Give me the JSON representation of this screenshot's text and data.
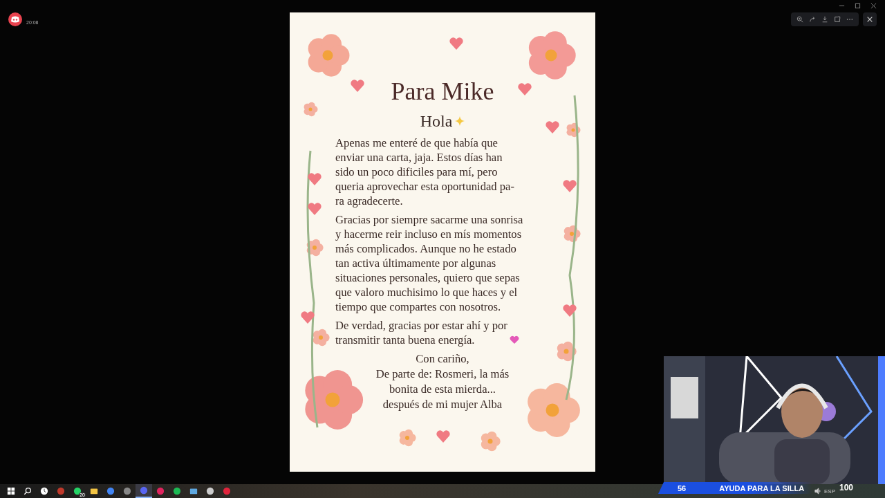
{
  "notification": {
    "time": "20:08"
  },
  "letter": {
    "title": "Para Mike",
    "greeting": "Hola",
    "paragraphs": [
      {
        "lines": [
          "Apenas me enteré de que había que",
          "enviar una carta, jaja. Estos días han",
          "sido un poco dificiles para mí, pero",
          "queria aprovechar esta oportunidad pa-",
          "ra agradecerte."
        ],
        "heart": false
      },
      {
        "lines": [
          "Gracias por siempre sacarme una sonrisa",
          "y hacerme reir incluso en mís momentos",
          "más complicados. Aunque no he estado",
          "tan activa últimamente por algunas",
          "situaciones personales, quiero que sepas",
          "que valoro muchisimo lo que haces y el",
          "tiempo que compartes con nosotros."
        ],
        "heart": false
      },
      {
        "lines": [
          "De verdad, gracias por estar ahí y por",
          "transmitir tanta buena energía."
        ],
        "heart": true
      }
    ],
    "closing": [
      "Con cariño,",
      "De parte de: Rosmeri, la más",
      "bonita de esta mierda...",
      "después de mi mujer Alba"
    ]
  },
  "viewer_toolbar": [
    {
      "kind": "zoom"
    },
    {
      "kind": "forward"
    },
    {
      "kind": "download"
    },
    {
      "kind": "external"
    },
    {
      "kind": "more"
    }
  ],
  "stream_overlay": {
    "count": "56",
    "goal": "AYUDA PARA LA SILLA",
    "total": "100"
  },
  "taskbar": {
    "apps": [
      {
        "kind": "windows",
        "selected": false
      },
      {
        "kind": "search",
        "selected": false
      },
      {
        "kind": "clock",
        "selected": false
      },
      {
        "kind": "game",
        "selected": false
      },
      {
        "kind": "chat",
        "selected": false,
        "badge": "20"
      },
      {
        "kind": "folder",
        "selected": false
      },
      {
        "kind": "browser",
        "selected": false
      },
      {
        "kind": "disc",
        "selected": false
      },
      {
        "kind": "discord",
        "selected": true
      },
      {
        "kind": "tiktok",
        "selected": false
      },
      {
        "kind": "music",
        "selected": false
      },
      {
        "kind": "window",
        "selected": false
      },
      {
        "kind": "mouse",
        "selected": false
      },
      {
        "kind": "record",
        "selected": false
      }
    ],
    "language": "ESP"
  }
}
